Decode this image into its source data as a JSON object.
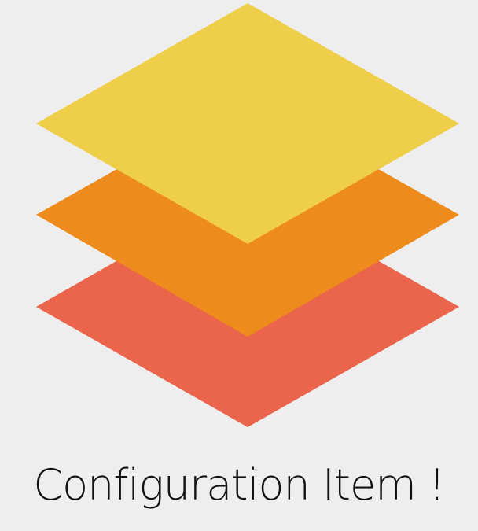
{
  "caption": "Configuration Item !",
  "icon": {
    "name": "stacked-layers-icon",
    "colors": {
      "bottom_layer": "#ea654b",
      "middle_layer": "#ed8b1d",
      "top_layer": "#efce4a"
    }
  },
  "colors": {
    "background": "#eeeeee",
    "text": "#111111"
  }
}
